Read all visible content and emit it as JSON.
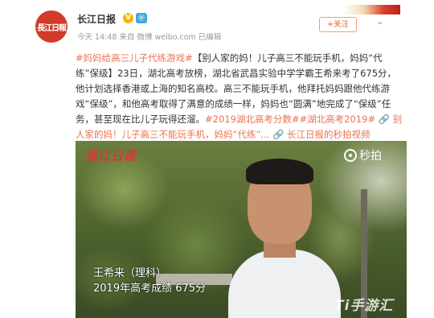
{
  "post": {
    "author": "长江日报",
    "avatar_text": "長江日報",
    "badge": "V",
    "badge2": "Ⓦ",
    "meta": "今天 14:48 来自 微博 weibo.com    已编辑",
    "follow_label": "+关注",
    "text": {
      "tag1": "#妈妈给高三儿子代练游戏#",
      "body1": "【别人家的妈！儿子高三不能玩手机，妈妈“代练”保级】23日，湖北高考放榜，湖北省武昌实验中学学霸王希来考了675分，他计划选择香港或上海的知名高校。高三不能玩手机，他拜托妈妈跟他代练游戏“保级”，和他高考取得了满意的成绩一样，妈妈也“圆满”地完成了“保级”任务，甚至现在比儿子玩得还溜。",
      "tag2": "#2019湖北高考分数##湖北高考2019#",
      "body2": " 🔗 别人家的妈！儿子高三不能玩手机，妈妈“代练”... ",
      "link": "🔗 长江日报的秒拍视频"
    }
  },
  "video": {
    "logo": "長江日報",
    "miaopai": "秒拍",
    "caption_line1": "王希来（理科）",
    "caption_line2": "2019年高考成绩 675分",
    "watermark": "Ti手游汇"
  },
  "colors": {
    "accent": "#eb7350",
    "follow": "#e8631e",
    "logo_red": "#d83a2c"
  }
}
